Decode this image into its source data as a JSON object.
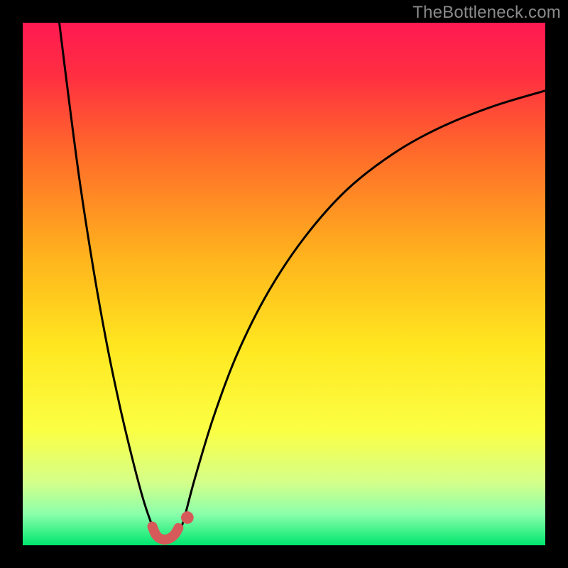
{
  "watermark": "TheBottleneck.com",
  "chart_data": {
    "type": "line",
    "title": "",
    "xlabel": "",
    "ylabel": "",
    "xlim": [
      0,
      100
    ],
    "ylim": [
      0,
      100
    ],
    "background_gradient_stops": [
      {
        "pos": 0.0,
        "color": "#ff1a52"
      },
      {
        "pos": 0.1,
        "color": "#ff2e41"
      },
      {
        "pos": 0.25,
        "color": "#ff6b2a"
      },
      {
        "pos": 0.45,
        "color": "#ffb41d"
      },
      {
        "pos": 0.62,
        "color": "#ffe720"
      },
      {
        "pos": 0.78,
        "color": "#fbff44"
      },
      {
        "pos": 0.88,
        "color": "#d4ff8a"
      },
      {
        "pos": 0.94,
        "color": "#8bffab"
      },
      {
        "pos": 1.0,
        "color": "#00e66e"
      }
    ],
    "series": [
      {
        "name": "left-curve",
        "stroke": "#000000",
        "stroke_width": 3,
        "points": [
          {
            "x": 7.0,
            "y": 100.0
          },
          {
            "x": 9.0,
            "y": 84.0
          },
          {
            "x": 11.0,
            "y": 69.0
          },
          {
            "x": 13.5,
            "y": 53.0
          },
          {
            "x": 16.0,
            "y": 39.0
          },
          {
            "x": 18.5,
            "y": 27.0
          },
          {
            "x": 21.0,
            "y": 16.5
          },
          {
            "x": 23.0,
            "y": 9.0
          },
          {
            "x": 24.5,
            "y": 4.5
          },
          {
            "x": 25.5,
            "y": 2.2
          }
        ]
      },
      {
        "name": "right-curve",
        "stroke": "#000000",
        "stroke_width": 3,
        "points": [
          {
            "x": 30.0,
            "y": 2.3
          },
          {
            "x": 31.0,
            "y": 5.5
          },
          {
            "x": 33.0,
            "y": 13.0
          },
          {
            "x": 36.5,
            "y": 24.5
          },
          {
            "x": 41.0,
            "y": 36.5
          },
          {
            "x": 47.0,
            "y": 48.5
          },
          {
            "x": 54.0,
            "y": 59.0
          },
          {
            "x": 62.0,
            "y": 68.0
          },
          {
            "x": 71.0,
            "y": 75.0
          },
          {
            "x": 80.0,
            "y": 80.0
          },
          {
            "x": 90.0,
            "y": 84.0
          },
          {
            "x": 100.0,
            "y": 87.0
          }
        ]
      },
      {
        "name": "valley-floor",
        "stroke": "#d65a5a",
        "stroke_width": 14,
        "linecap": "round",
        "points": [
          {
            "x": 24.8,
            "y": 3.6
          },
          {
            "x": 25.5,
            "y": 2.0
          },
          {
            "x": 26.5,
            "y": 1.2
          },
          {
            "x": 27.8,
            "y": 1.2
          },
          {
            "x": 29.0,
            "y": 2.0
          },
          {
            "x": 29.8,
            "y": 3.3
          }
        ]
      }
    ],
    "markers": [
      {
        "name": "right-bump",
        "shape": "circle",
        "x": 31.5,
        "y": 5.3,
        "r": 1.2,
        "fill": "#d65a5a"
      }
    ]
  }
}
